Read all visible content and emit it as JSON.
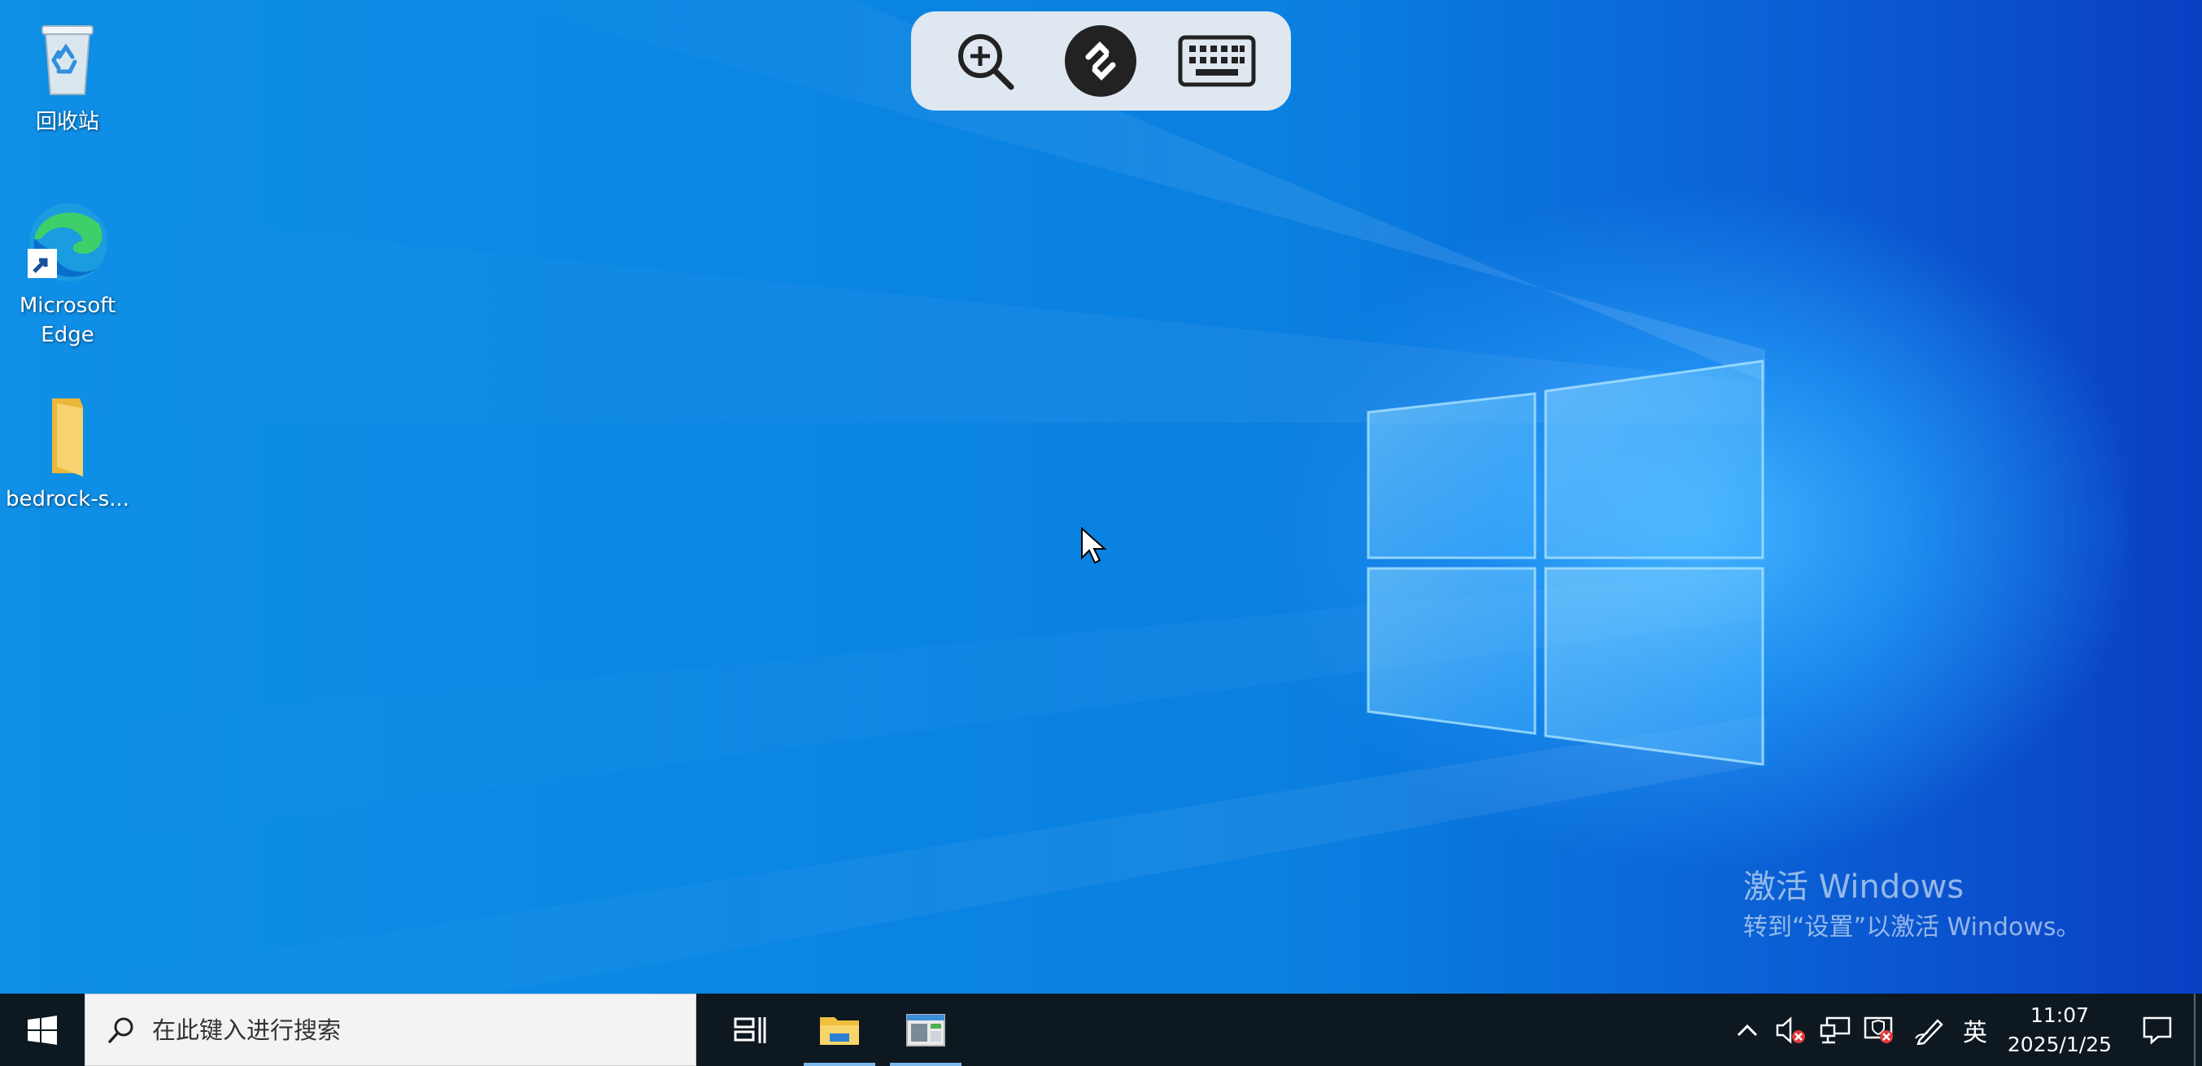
{
  "desktop": {
    "icons": [
      {
        "label": "回收站",
        "icon": "recycle-bin-icon"
      },
      {
        "label": "Microsoft\nEdge",
        "icon": "edge-icon"
      },
      {
        "label": "bedrock-s...",
        "icon": "folder-icon"
      }
    ],
    "watermark": {
      "title": "激活 Windows",
      "subtitle": "转到“设置”以激活 Windows。"
    }
  },
  "remote_toolbar": {
    "buttons": [
      "zoom-in-icon",
      "remote-desktop-icon",
      "keyboard-icon"
    ]
  },
  "taskbar": {
    "search_placeholder": "在此键入进行搜索",
    "pinned": [
      "task-view-icon",
      "file-explorer-icon",
      "app-window-icon"
    ],
    "tray": {
      "ime_label": "英",
      "time": "11:07",
      "date": "2025/1/25"
    }
  },
  "colors": {
    "taskbar": "#0e1820",
    "desktop_blue": "#0a86e4",
    "toolbar": "#dfe8f1"
  }
}
